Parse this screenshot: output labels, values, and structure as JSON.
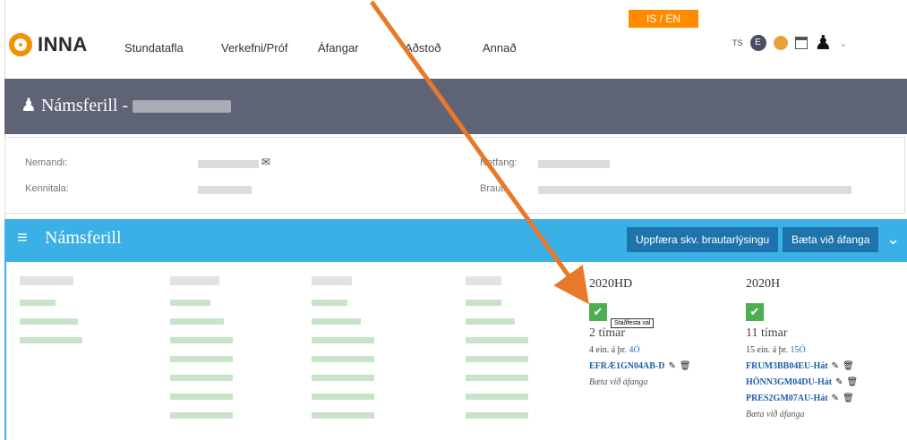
{
  "lang_switch": "IS / EN",
  "logo_text": "INNA",
  "nav": [
    "Stundatafla",
    "Verkefni/Próf",
    "Áfangar",
    "Aðstoð",
    "Annað"
  ],
  "icons": {
    "ts_label": "TS",
    "profile_initial": "E"
  },
  "title_bar": {
    "title": "Námsferill -"
  },
  "info": {
    "nemandi_label": "Nemandi:",
    "kennitala_label": "Kennitala:",
    "netfang_label": "Netfang:",
    "braut_label": "Braut:"
  },
  "section": {
    "title": "Námsferill",
    "update_btn": "Uppfæra skv. brautarlýsingu",
    "add_btn": "Bæta við áfanga"
  },
  "semesters": [
    {
      "name": "2020HD",
      "hours": "2 tímar",
      "ein_prefix": "4 ein. á þr.",
      "ein_value": "4Ó",
      "courses": [
        "EFRÆ1GN04AB-D"
      ],
      "add_label": "Bæta við áfanga"
    },
    {
      "name": "2020H",
      "hours": "11 tímar",
      "ein_prefix": "15 ein. á þr.",
      "ein_value": "15Ó",
      "courses": [
        "FRUM3BB04EU-Hát",
        "HÖNN3GM04DU-Hát",
        "PRES2GM07AU-Hát"
      ],
      "add_label": "Bæta við áfanga"
    }
  ],
  "tooltip": "Staðfesta val",
  "colors": {
    "accent": "#3bb0e6",
    "title_bar": "#5f6376",
    "brand": "#f39200",
    "check": "#4caf50",
    "arrow": "#e8782a"
  }
}
